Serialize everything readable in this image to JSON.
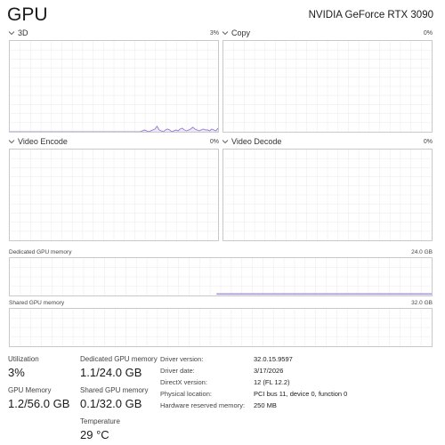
{
  "header": {
    "title": "GPU",
    "model": "NVIDIA GeForce RTX 3090"
  },
  "engines": [
    {
      "name": "3D",
      "percent": "3%",
      "samples": [
        0,
        0,
        0,
        0,
        0,
        0,
        0,
        0,
        0,
        0,
        0,
        0,
        0,
        0,
        0,
        0,
        0,
        0,
        0,
        0,
        0,
        0,
        0,
        0,
        0,
        0,
        0,
        0,
        0,
        0,
        0,
        0,
        0,
        0,
        0,
        0,
        0,
        0,
        0,
        0,
        0,
        0,
        0,
        0,
        0,
        0,
        0,
        0,
        0,
        0,
        0,
        0,
        0,
        0,
        0,
        0,
        0,
        0,
        0,
        0,
        0,
        0,
        0,
        1,
        2,
        1,
        0,
        1,
        2,
        3,
        6,
        2,
        1,
        0,
        2,
        3,
        2,
        0,
        1,
        2,
        1,
        3,
        4,
        2,
        1,
        2,
        3,
        5,
        3,
        2,
        1,
        2,
        3,
        2,
        2,
        1,
        3,
        2,
        1,
        4
      ]
    },
    {
      "name": "Copy",
      "percent": "0%",
      "samples": []
    },
    {
      "name": "Video Encode",
      "percent": "0%",
      "samples": []
    },
    {
      "name": "Video Decode",
      "percent": "0%",
      "samples": []
    }
  ],
  "dedicated_memory_graph": {
    "label": "Dedicated GPU memory",
    "max": "24.0 GB",
    "start_fraction": 0.49,
    "level": 0.045
  },
  "shared_memory_graph": {
    "label": "Shared GPU memory",
    "max": "32.0 GB",
    "level": 0
  },
  "stats": {
    "utilization_label": "Utilization",
    "utilization_value": "3%",
    "dedicated_label": "Dedicated GPU memory",
    "dedicated_value": "1.1/24.0 GB",
    "gpu_memory_label": "GPU Memory",
    "gpu_memory_value": "1.2/56.0 GB",
    "shared_label": "Shared GPU memory",
    "shared_value": "0.1/32.0 GB",
    "temperature_label": "Temperature",
    "temperature_value": "29 °C"
  },
  "info": [
    {
      "label": "Driver version:",
      "value": "32.0.15.9597"
    },
    {
      "label": "Driver date:",
      "value": "3/17/2026"
    },
    {
      "label": "DirectX version:",
      "value": "12 (FL 12.2)"
    },
    {
      "label": "Physical location:",
      "value": "PCI bus 11, device 0, function 0"
    },
    {
      "label": "Hardware reserved memory:",
      "value": "250 MB"
    }
  ],
  "colors": {
    "line": "#8a6fd1",
    "fill": "#ede7fa",
    "grid": "#eeeeee",
    "border": "#c9c9c9"
  }
}
